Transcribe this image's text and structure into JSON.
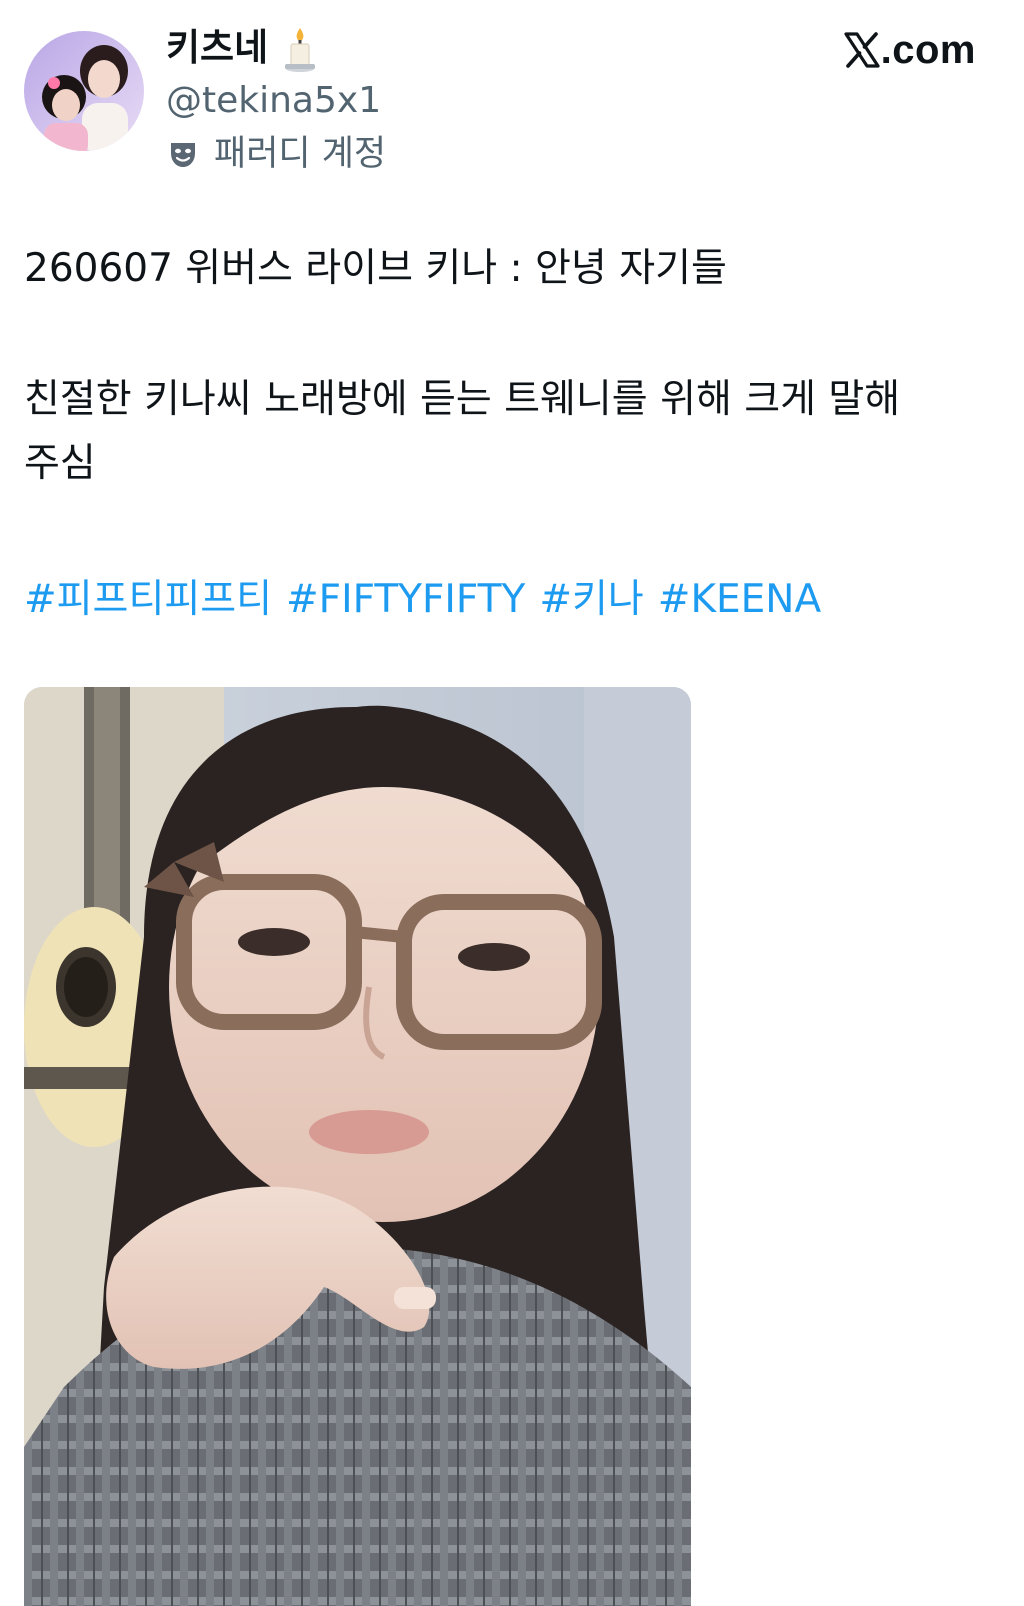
{
  "author": {
    "display_name": "키츠네",
    "handle": "@tekina5x1",
    "parody_label": "패러디 계정",
    "avatar_icon": "avatar-photo",
    "name_emoji_icon": "candle-icon",
    "parody_icon": "theater-mask-icon"
  },
  "brand": {
    "domain": ".com",
    "logo_icon": "x-logo-icon"
  },
  "tweet": {
    "line1": "260607 위버스 라이브 키나 : 안녕 자기들",
    "line2": "친절한 키나씨 노래방에 듣는 트웨니를 위해 크게 말해",
    "line3": "주심",
    "hashtags": [
      "#피프티피프티",
      "#FIFTYFIFTY",
      "#키나",
      "#KEENA"
    ]
  },
  "media": {
    "type": "live-stream-photo"
  },
  "colors": {
    "text": "#0f1419",
    "secondary": "#536471",
    "link": "#1d9bf0",
    "background": "#ffffff"
  }
}
